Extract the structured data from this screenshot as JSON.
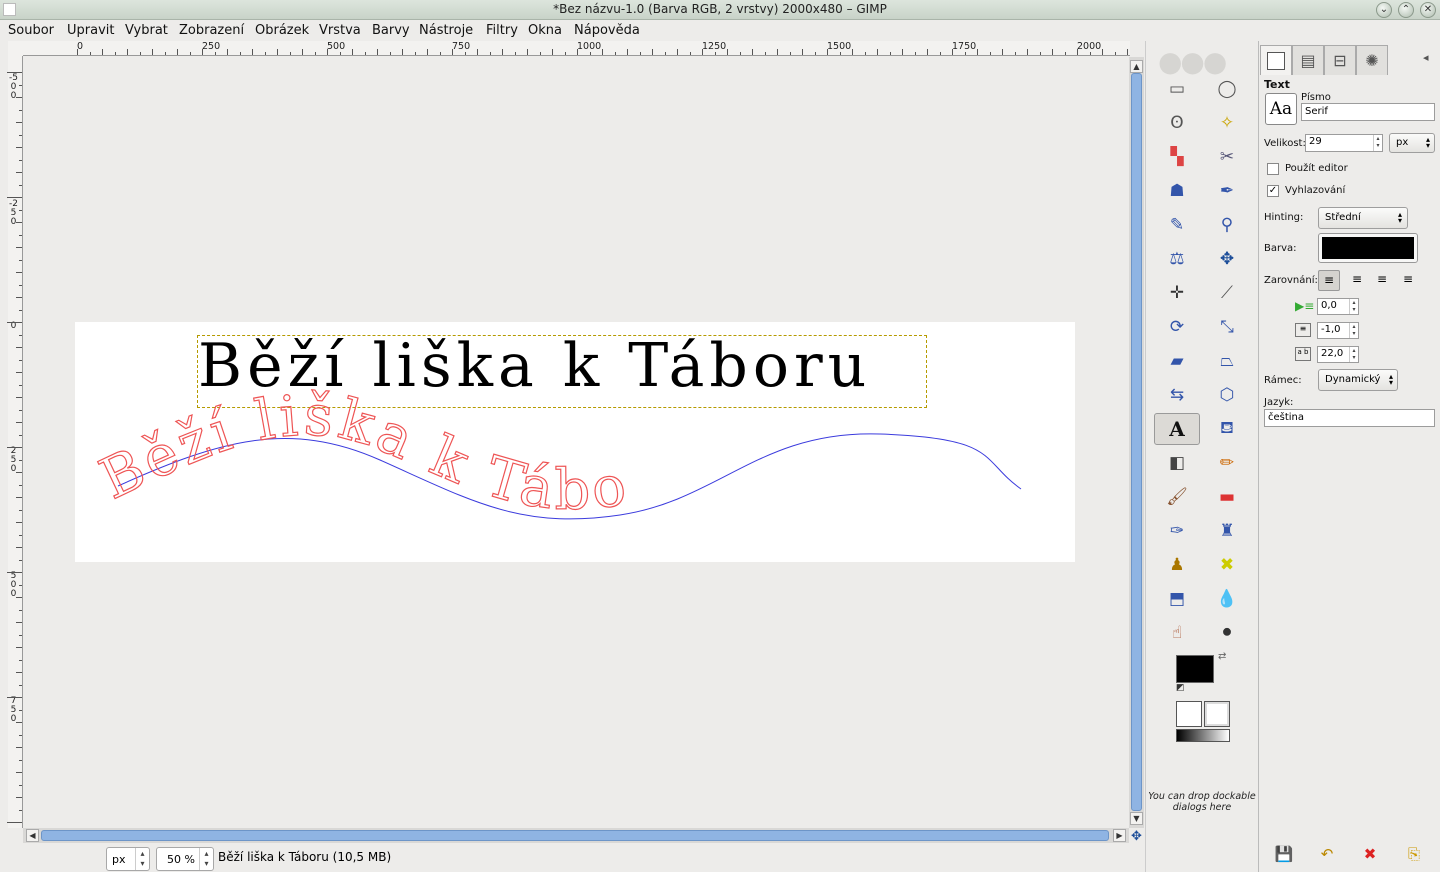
{
  "window": {
    "title": "*Bez názvu-1.0 (Barva RGB, 2 vrstvy) 2000x480 – GIMP",
    "min_label": "⌄",
    "max_label": "⌃",
    "close_label": "✕"
  },
  "menubar": {
    "items": [
      "Soubor",
      "Upravit",
      "Vybrat",
      "Zobrazení",
      "Obrázek",
      "Vrstva",
      "Barvy",
      "Nástroje",
      "Filtry",
      "Okna",
      "Nápověda"
    ]
  },
  "ruler": {
    "h_labels": [
      "0",
      "250",
      "500",
      "750",
      "1000",
      "1250",
      "1500",
      "1750",
      "2000"
    ],
    "v_labels": [
      "-500",
      "-250",
      "0",
      "250",
      "500",
      "750"
    ]
  },
  "canvas": {
    "text_layer": "Běží liška k Táboru",
    "curve_text": "Běží liška k Tábo",
    "text_color": "#000000",
    "curve_text_color": "#ee5555",
    "path_color": "#3b3bdd"
  },
  "statusbar": {
    "unit": "px",
    "zoom": "50 %",
    "message": "Běží liška k Táboru (10,5 MB)"
  },
  "toolbox": {
    "drop_hint": "You can drop dockable dialogs here",
    "fg_color": "#000000",
    "bg_color": "#ffffff"
  },
  "tool_options": {
    "section_title": "Text",
    "font_label": "Písmo",
    "font_preview": "Aa",
    "font_value": "Serif",
    "size_label": "Velikost:",
    "size_value": "29",
    "size_unit": "px",
    "use_editor_label": "Použít editor",
    "use_editor_checked": false,
    "antialias_label": "Vyhlazování",
    "antialias_checked": true,
    "hinting_label": "Hinting:",
    "hinting_value": "Střední",
    "color_label": "Barva:",
    "color_value": "#000000",
    "justify_label": "Zarovnání:",
    "indent_value": "0,0",
    "line_spacing_value": "-1,0",
    "letter_spacing_value": "22,0",
    "box_label": "Rámec:",
    "box_value": "Dynamický",
    "language_label": "Jazyk:",
    "language_value": "čeština"
  }
}
